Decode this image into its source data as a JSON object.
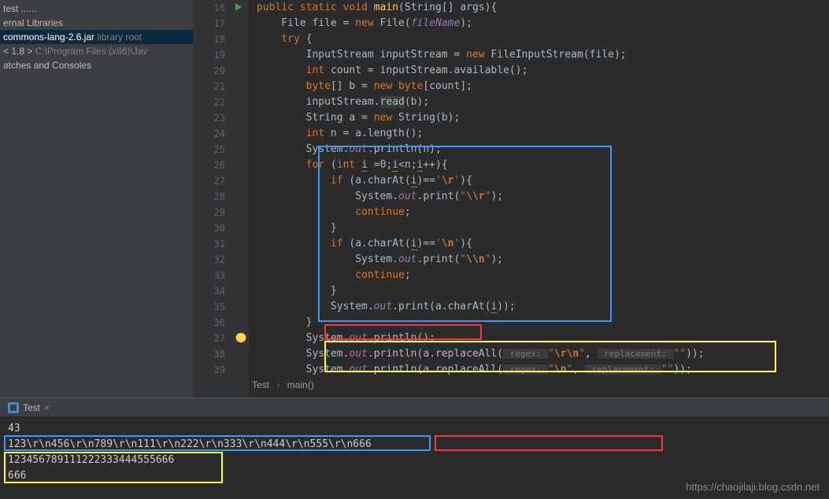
{
  "sidebar": {
    "items": [
      {
        "label": "test ......"
      },
      {
        "label": "ernal Libraries"
      },
      {
        "label": "commons-lang-2.6.jar",
        "suffix": " library root"
      },
      {
        "label": "< 1.8 >",
        "suffix": "  C:\\Program Files (x86)\\Jav"
      },
      {
        "label": "atches and Consoles"
      }
    ]
  },
  "gutter": {
    "start": 16,
    "end": 39
  },
  "code": {
    "lines": {
      "l16": {
        "indent": "    ",
        "tokens": [
          [
            "kw",
            "public"
          ],
          [
            "",
            ""
          ],
          [
            "kw",
            " static"
          ],
          [
            "",
            ""
          ],
          [
            "kw",
            " void"
          ],
          [
            "",
            " main(String[] args){"
          ]
        ]
      },
      "l17": "        File file = new File(fileName);",
      "l18": "        try {",
      "l19": "            InputStream inputStream = new FileInputStream(file);",
      "l20": "            int count = inputStream.available();",
      "l21": "            byte[] b = new byte[count];",
      "l22": "            inputStream.read(b);",
      "l23": "            String a = new String(b);",
      "l24": "            int n = a.length();",
      "l25": "            System.out.println(n);",
      "l26": "            for (int i =0;i<n;i++){",
      "l27": "                if (a.charAt(i)=='\\r'){",
      "l28": "                    System.out.print(\"\\\\r\");",
      "l29": "                    continue;",
      "l30": "                }",
      "l31": "                if (a.charAt(i)=='\\n'){",
      "l32": "                    System.out.print(\"\\\\n\");",
      "l33": "                    continue;",
      "l34": "                }",
      "l35": "                System.out.print(a.charAt(i));",
      "l36": "            }",
      "l37": "            System.out.println();",
      "l38_a": "            System.out.println(a.replaceAll(",
      "l38_hint1": " regex: ",
      "l38_str1": "\"\\r\\n\"",
      "l38_mid": ", ",
      "l38_hint2": " replacement: ",
      "l38_str2": "\"\"",
      "l38_end": "));",
      "l39_a": "            System.out.println(a.replaceAll(",
      "l39_hint1": " regex: ",
      "l39_str1": "\"\\n\"",
      "l39_mid": ", ",
      "l39_hint2": " replacement: ",
      "l39_str2": "\"\"",
      "l39_end": "));"
    }
  },
  "breadcrumb": {
    "class": "Test",
    "method": "main()"
  },
  "console_tab": {
    "label": "Test"
  },
  "console": {
    "lines": [
      "43",
      "123\\r\\n456\\r\\n789\\r\\n111\\r\\n222\\r\\n333\\r\\n444\\r\\n555\\r\\n666",
      "123456789111222333444555666",
      "666"
    ]
  },
  "watermark": "https://chaojilaji.blog.csdn.net"
}
